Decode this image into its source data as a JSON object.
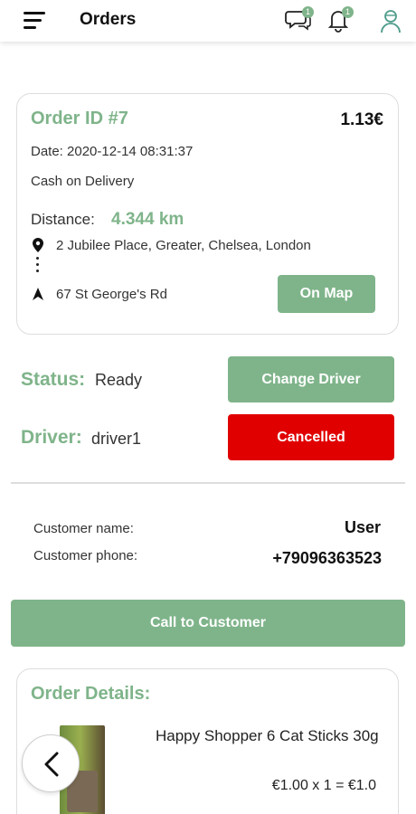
{
  "header": {
    "title": "Orders",
    "chat_badge": "1",
    "notifications_badge": "1"
  },
  "order": {
    "id_label": "Order ID #7",
    "total": "1.13€",
    "date": "Date: 2020-12-14 08:31:37",
    "payment": "Cash on Delivery",
    "distance_label": "Distance:",
    "distance_value": "4.344 km",
    "from_address": "2 Jubilee Place, Greater, Chelsea, London",
    "to_address": "67 St George's Rd",
    "map_button": "On Map"
  },
  "status": {
    "label": "Status:",
    "value": "Ready",
    "change_driver_button": "Change Driver"
  },
  "driver": {
    "label": "Driver:",
    "value": "driver1",
    "cancelled_button": "Cancelled"
  },
  "customer": {
    "name_label": "Customer name:",
    "name_value": "User",
    "phone_label": "Customer phone:",
    "phone_value": "+79096363523",
    "call_button": "Call to Customer"
  },
  "details": {
    "title": "Order Details:",
    "items": [
      {
        "name": "Happy Shopper 6 Cat Sticks 30g",
        "price_line": "€1.00 x 1 = €1.0"
      }
    ]
  },
  "colors": {
    "accent_green": "#7fb48a",
    "danger_red": "#e00000"
  },
  "icons": [
    "menu-icon",
    "chat-icon",
    "bell-icon",
    "user-avatar-icon",
    "map-pin-icon",
    "navigation-arrow-icon",
    "back-arrow-icon"
  ]
}
